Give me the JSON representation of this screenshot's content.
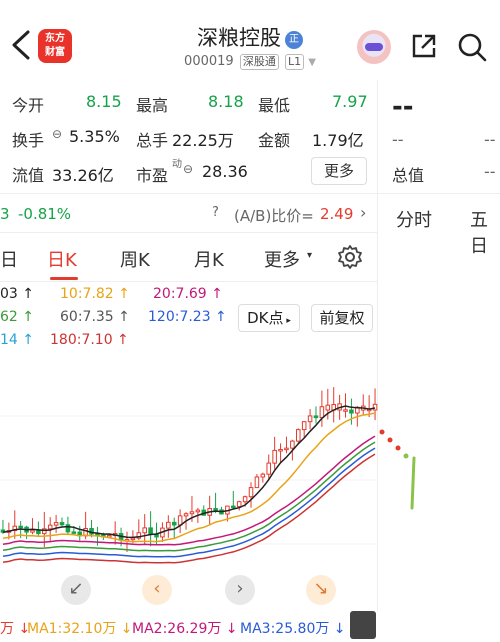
{
  "header": {
    "title": "深粮控股",
    "title_badge": "正",
    "code": "000019",
    "exchange_tag": "深股通",
    "level_tag": "L1",
    "logo_line1": "东方",
    "logo_line2": "财富"
  },
  "quote": {
    "open_label": "今开",
    "open_value": "8.15",
    "high_label": "最高",
    "high_value": "8.18",
    "low_label": "最低",
    "low_value": "7.97",
    "turnover_label": "换手",
    "turnover_value": "5.35%",
    "volume_label": "总手",
    "volume_value": "22.25万",
    "amount_label": "金额",
    "amount_value": "1.79亿",
    "float_label": "流值",
    "float_value": "33.26亿",
    "pe_label": "市盈",
    "pe_super": "动",
    "pe_value": "28.36",
    "more_label": "更多",
    "right_price": "--",
    "right_value1": "--",
    "right_value2": "--",
    "total_value_label": "总值",
    "total_value_value": "--"
  },
  "ratio_row": {
    "change": "-0.81%",
    "ab_label": "(A/B)比价=",
    "ab_value": "2.49",
    "left_fragment": "3"
  },
  "tabs": {
    "partial": "日",
    "day": "日K",
    "week": "周K",
    "month": "月K",
    "more": "更多",
    "intraday": "分时",
    "five_day": "五日"
  },
  "ma_lines": {
    "row1": [
      "03 ↑",
      "10:7.82 ↑",
      "20:7.69 ↑"
    ],
    "row2": [
      "62 ↑",
      "60:7.35 ↑",
      "120:7.23 ↑"
    ],
    "row3": [
      "14 ↑",
      "180:7.10 ↑"
    ],
    "dk_label": "DK点",
    "fq_label": "前复权"
  },
  "bottom": {
    "vol_fragment": "万 ↓",
    "ma1": "MA1:32.10万 ↓",
    "ma2": "MA2:26.29万 ↓",
    "ma3": "MA3:25.80万 ↓"
  },
  "colors": {
    "up": "#e33b2e",
    "down": "#16a34a",
    "ma5": "#222222",
    "ma10": "#e8a317",
    "ma20": "#c2187a",
    "ma60": "#3a9b3a",
    "ma120": "#2a5bd7",
    "ma180": "#cc3333"
  }
}
